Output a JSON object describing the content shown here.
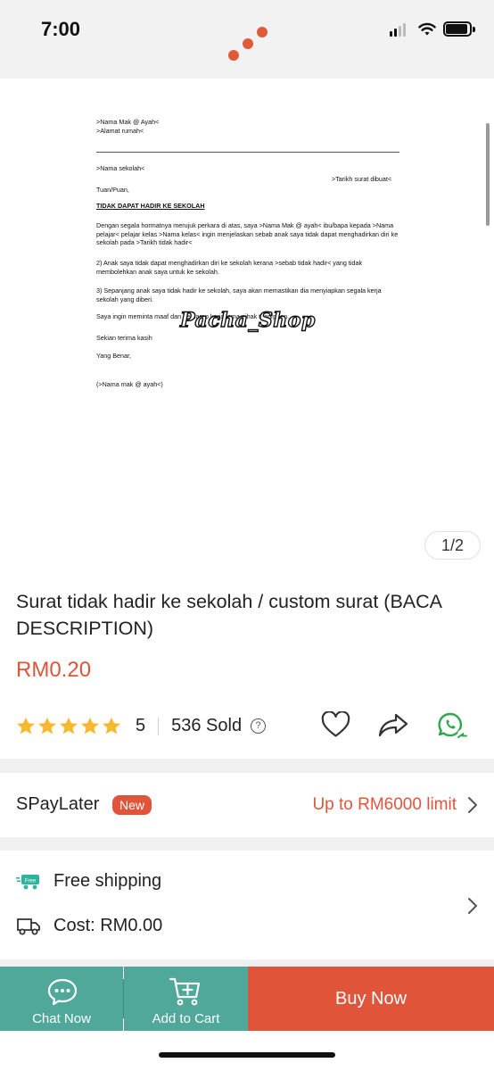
{
  "status_bar": {
    "time": "7:00"
  },
  "gallery": {
    "page_indicator": "1/2",
    "watermark": "Pacha_Shop",
    "document": {
      "address_lines": [
        ">Nama Mak @ Ayah<",
        ">Alamat rumah<"
      ],
      "school": ">Nama sekolah<",
      "date": ">Tarikh surat dibuat<",
      "salutation": "Tuan/Puan,",
      "subject": "TIDAK DAPAT HADIR KE SEKOLAH",
      "para1": "Dengan segala hormatnya merujuk perkara di atas, saya >Nama Mak @ ayah< ibu/bapa kepada >Nama pelajar< pelajar kelas >Nama kelas< ingin menjelaskan sebab anak saya tidak dapat menghadirkan diri ke sekolah pada >Tarikh tidak hadir<",
      "para2": "2) Anak saya tidak dapat menghadirkan diri ke sekolah kerana >sebab tidak hadir< yang tidak membolehkan anak saya untuk ke sekolah.",
      "para3": "3) Sepanjang anak saya tidak hadir ke sekolah, saya akan memastikan dia menyiapkan segala kerja sekolah yang diberi.",
      "para4": "Saya ingin meminta maaf dan berharap kerjasama pihak tuan/puan.",
      "closing1": "Sekian terima kasih",
      "closing2": "Yang Benar,",
      "signature": "(>Nama mak @ ayah<)"
    }
  },
  "product": {
    "title": "Surat tidak hadir ke sekolah / custom surat (BACA DESCRIPTION)",
    "price": "RM0.20",
    "rating": "5",
    "rating_value": 5,
    "sold": "536 Sold",
    "help_glyph": "?"
  },
  "spaylater": {
    "label": "SPayLater",
    "badge": "New",
    "limit": "Up to RM6000 limit"
  },
  "shipping": {
    "free_badge": "Free",
    "free_label": "Free shipping",
    "cost_label": "Cost: RM0.00"
  },
  "bottom_bar": {
    "chat_label": "Chat Now",
    "cart_label": "Add to Cart",
    "buy_label": "Buy Now"
  },
  "colors": {
    "accent": "#e0553a",
    "teal": "#4fa89a",
    "star": "#f5b82e",
    "whatsapp": "#2ea84a"
  }
}
